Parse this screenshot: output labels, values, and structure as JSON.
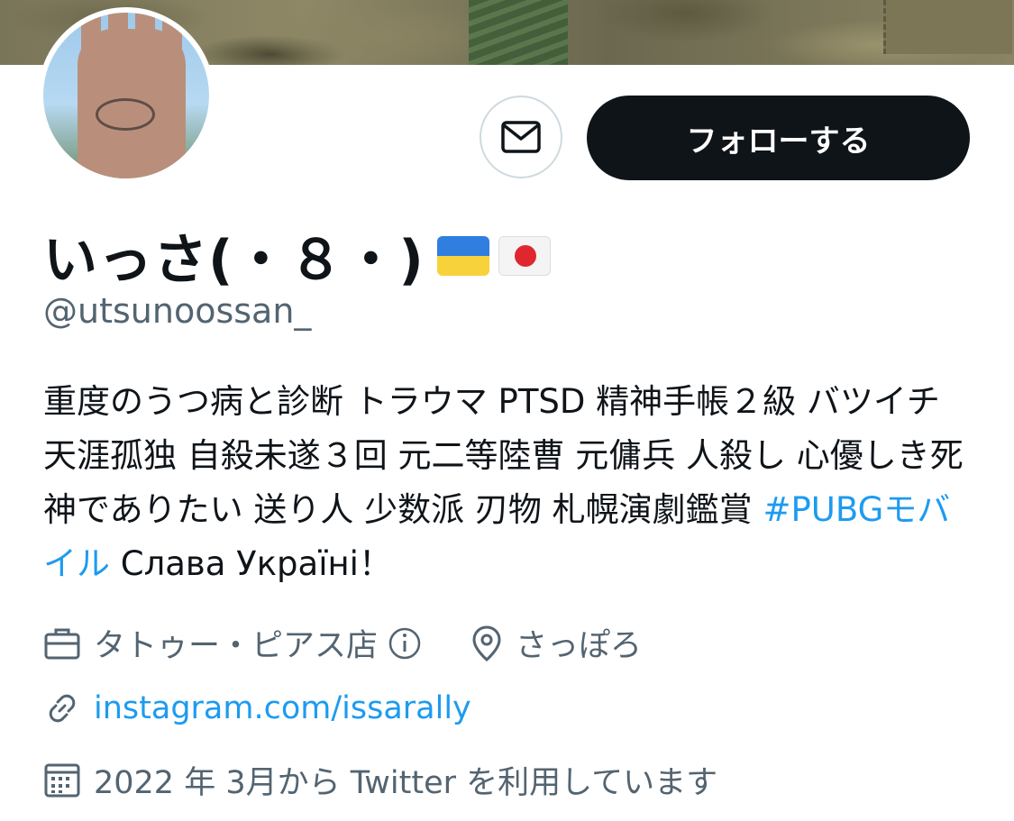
{
  "profile": {
    "display_name": "いっさ(・８・)",
    "flags": [
      "ukraine-flag-icon",
      "japan-flag-icon"
    ],
    "handle": "@utsunoossan_",
    "bio_text": "重度のうつ病と診断 トラウマ PTSD 精神手帳２級 バツイチ 天涯孤独 自殺未遂３回 元二等陸曹 元傭兵 人殺し 心優しき死神でありたい 送り人 少数派 刃物 札幌演劇鑑賞 ",
    "bio_hashtag": "#PUBGモバイル",
    "bio_tail": " Слава Україні！",
    "category": "タトゥー・ピアス店",
    "location": "さっぽろ",
    "website": "instagram.com/issarally",
    "joined": "2022 年 3月から Twitter を利用しています"
  },
  "actions": {
    "follow_label": "フォローする"
  },
  "colors": {
    "link": "#1d9bf0",
    "secondary_text": "#536471",
    "button_dark": "#0f1419"
  }
}
